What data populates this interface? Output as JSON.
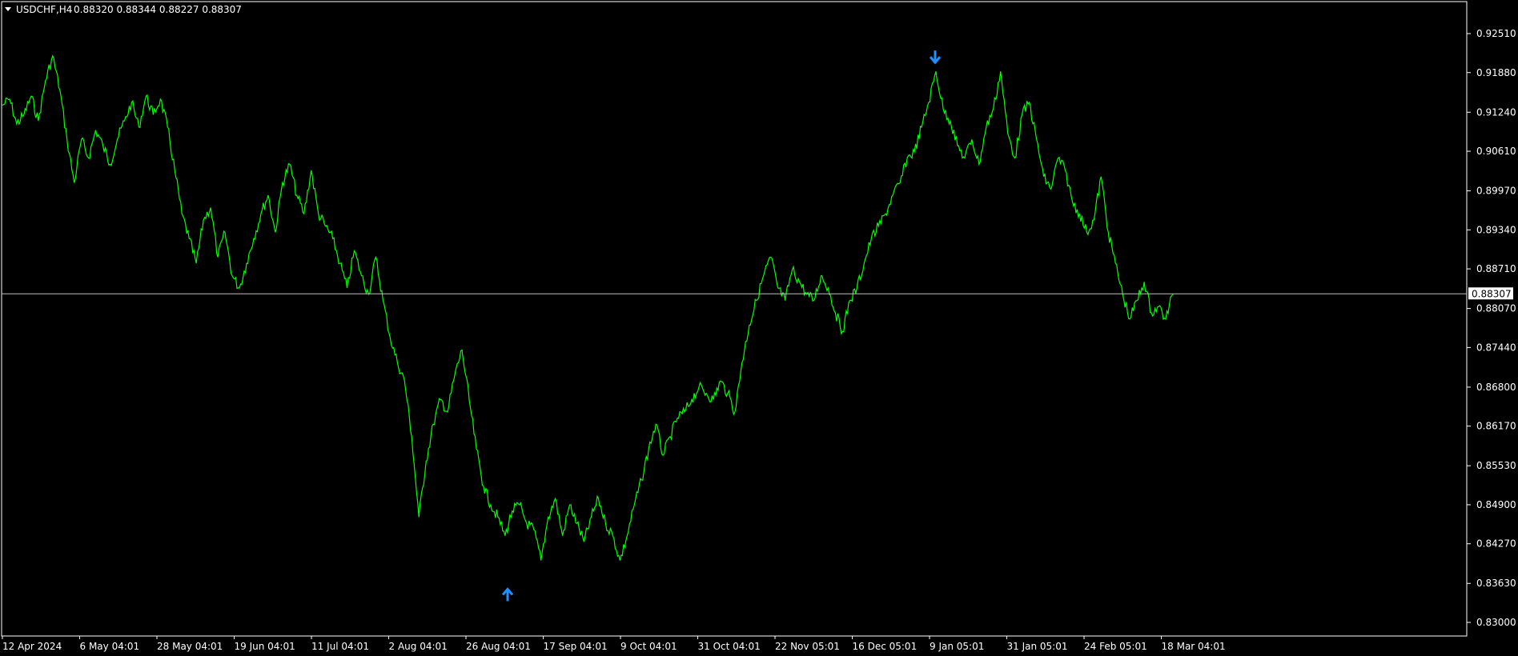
{
  "header": {
    "dropdown_icon": "triangle-down-icon",
    "symbol": "USDCHF,H4",
    "ohlc": "0.88320 0.88344 0.88227 0.88307"
  },
  "colors": {
    "background": "#000000",
    "frame": "#ffffff",
    "price_line": "#00ff00",
    "current_line": "#c0c0c0",
    "marker": "#1e90ff",
    "text": "#ffffff"
  },
  "chart_data": {
    "type": "line",
    "x_axis_labels": [
      "12 Apr 2024",
      "6 May 04:01",
      "28 May 04:01",
      "19 Jun 04:01",
      "11 Jul 04:01",
      "2 Aug 04:01",
      "26 Aug 04:01",
      "17 Sep 04:01",
      "9 Oct 04:01",
      "31 Oct 04:01",
      "22 Nov 05:01",
      "16 Dec 05:01",
      "9 Jan 05:01",
      "31 Jan 05:01",
      "24 Feb 05:01",
      "18 Mar 04:01"
    ],
    "y_ticks": [
      "0.92510",
      "0.91880",
      "0.91240",
      "0.90610",
      "0.89970",
      "0.89340",
      "0.88710",
      "0.88070",
      "0.87440",
      "0.86800",
      "0.86170",
      "0.85530",
      "0.84900",
      "0.84270",
      "0.83630",
      "0.83000"
    ],
    "ylim": [
      0.83,
      0.9251
    ],
    "current_price": 0.88307,
    "current_price_label": "0.88307",
    "series": [
      {
        "values": [
          0.9135,
          0.9145,
          0.9105,
          0.912,
          0.915,
          0.911,
          0.9175,
          0.9215,
          0.916,
          0.908,
          0.901,
          0.908,
          0.905,
          0.9095,
          0.907,
          0.904,
          0.908,
          0.911,
          0.914,
          0.91,
          0.915,
          0.912,
          0.9145,
          0.91,
          0.903,
          0.896,
          0.892,
          0.888,
          0.895,
          0.897,
          0.889,
          0.893,
          0.886,
          0.884,
          0.888,
          0.892,
          0.896,
          0.899,
          0.893,
          0.901,
          0.904,
          0.899,
          0.896,
          0.903,
          0.896,
          0.894,
          0.892,
          0.888,
          0.884,
          0.89,
          0.886,
          0.883,
          0.889,
          0.882,
          0.876,
          0.872,
          0.869,
          0.86,
          0.847,
          0.856,
          0.862,
          0.866,
          0.864,
          0.87,
          0.874,
          0.866,
          0.858,
          0.852,
          0.849,
          0.847,
          0.844,
          0.848,
          0.849,
          0.846,
          0.845,
          0.84,
          0.847,
          0.85,
          0.844,
          0.849,
          0.846,
          0.843,
          0.847,
          0.85,
          0.846,
          0.844,
          0.84,
          0.844,
          0.849,
          0.853,
          0.858,
          0.862,
          0.857,
          0.86,
          0.863,
          0.864,
          0.866,
          0.868,
          0.867,
          0.866,
          0.869,
          0.867,
          0.864,
          0.872,
          0.878,
          0.882,
          0.886,
          0.889,
          0.884,
          0.882,
          0.887,
          0.885,
          0.883,
          0.882,
          0.886,
          0.884,
          0.88,
          0.877,
          0.882,
          0.884,
          0.888,
          0.892,
          0.894,
          0.896,
          0.899,
          0.901,
          0.905,
          0.906,
          0.91,
          0.914,
          0.919,
          0.913,
          0.911,
          0.907,
          0.905,
          0.908,
          0.904,
          0.91,
          0.913,
          0.919,
          0.909,
          0.905,
          0.912,
          0.914,
          0.908,
          0.902,
          0.9,
          0.905,
          0.903,
          0.898,
          0.896,
          0.893,
          0.895,
          0.902,
          0.893,
          0.888,
          0.883,
          0.879,
          0.882,
          0.885,
          0.88,
          0.881,
          0.879,
          0.883
        ]
      }
    ],
    "markers": [
      {
        "type": "sell",
        "icon": "arrow-down-icon",
        "price": 0.9203
      },
      {
        "type": "buy",
        "icon": "arrow-up-icon",
        "price": 0.8355
      }
    ]
  }
}
